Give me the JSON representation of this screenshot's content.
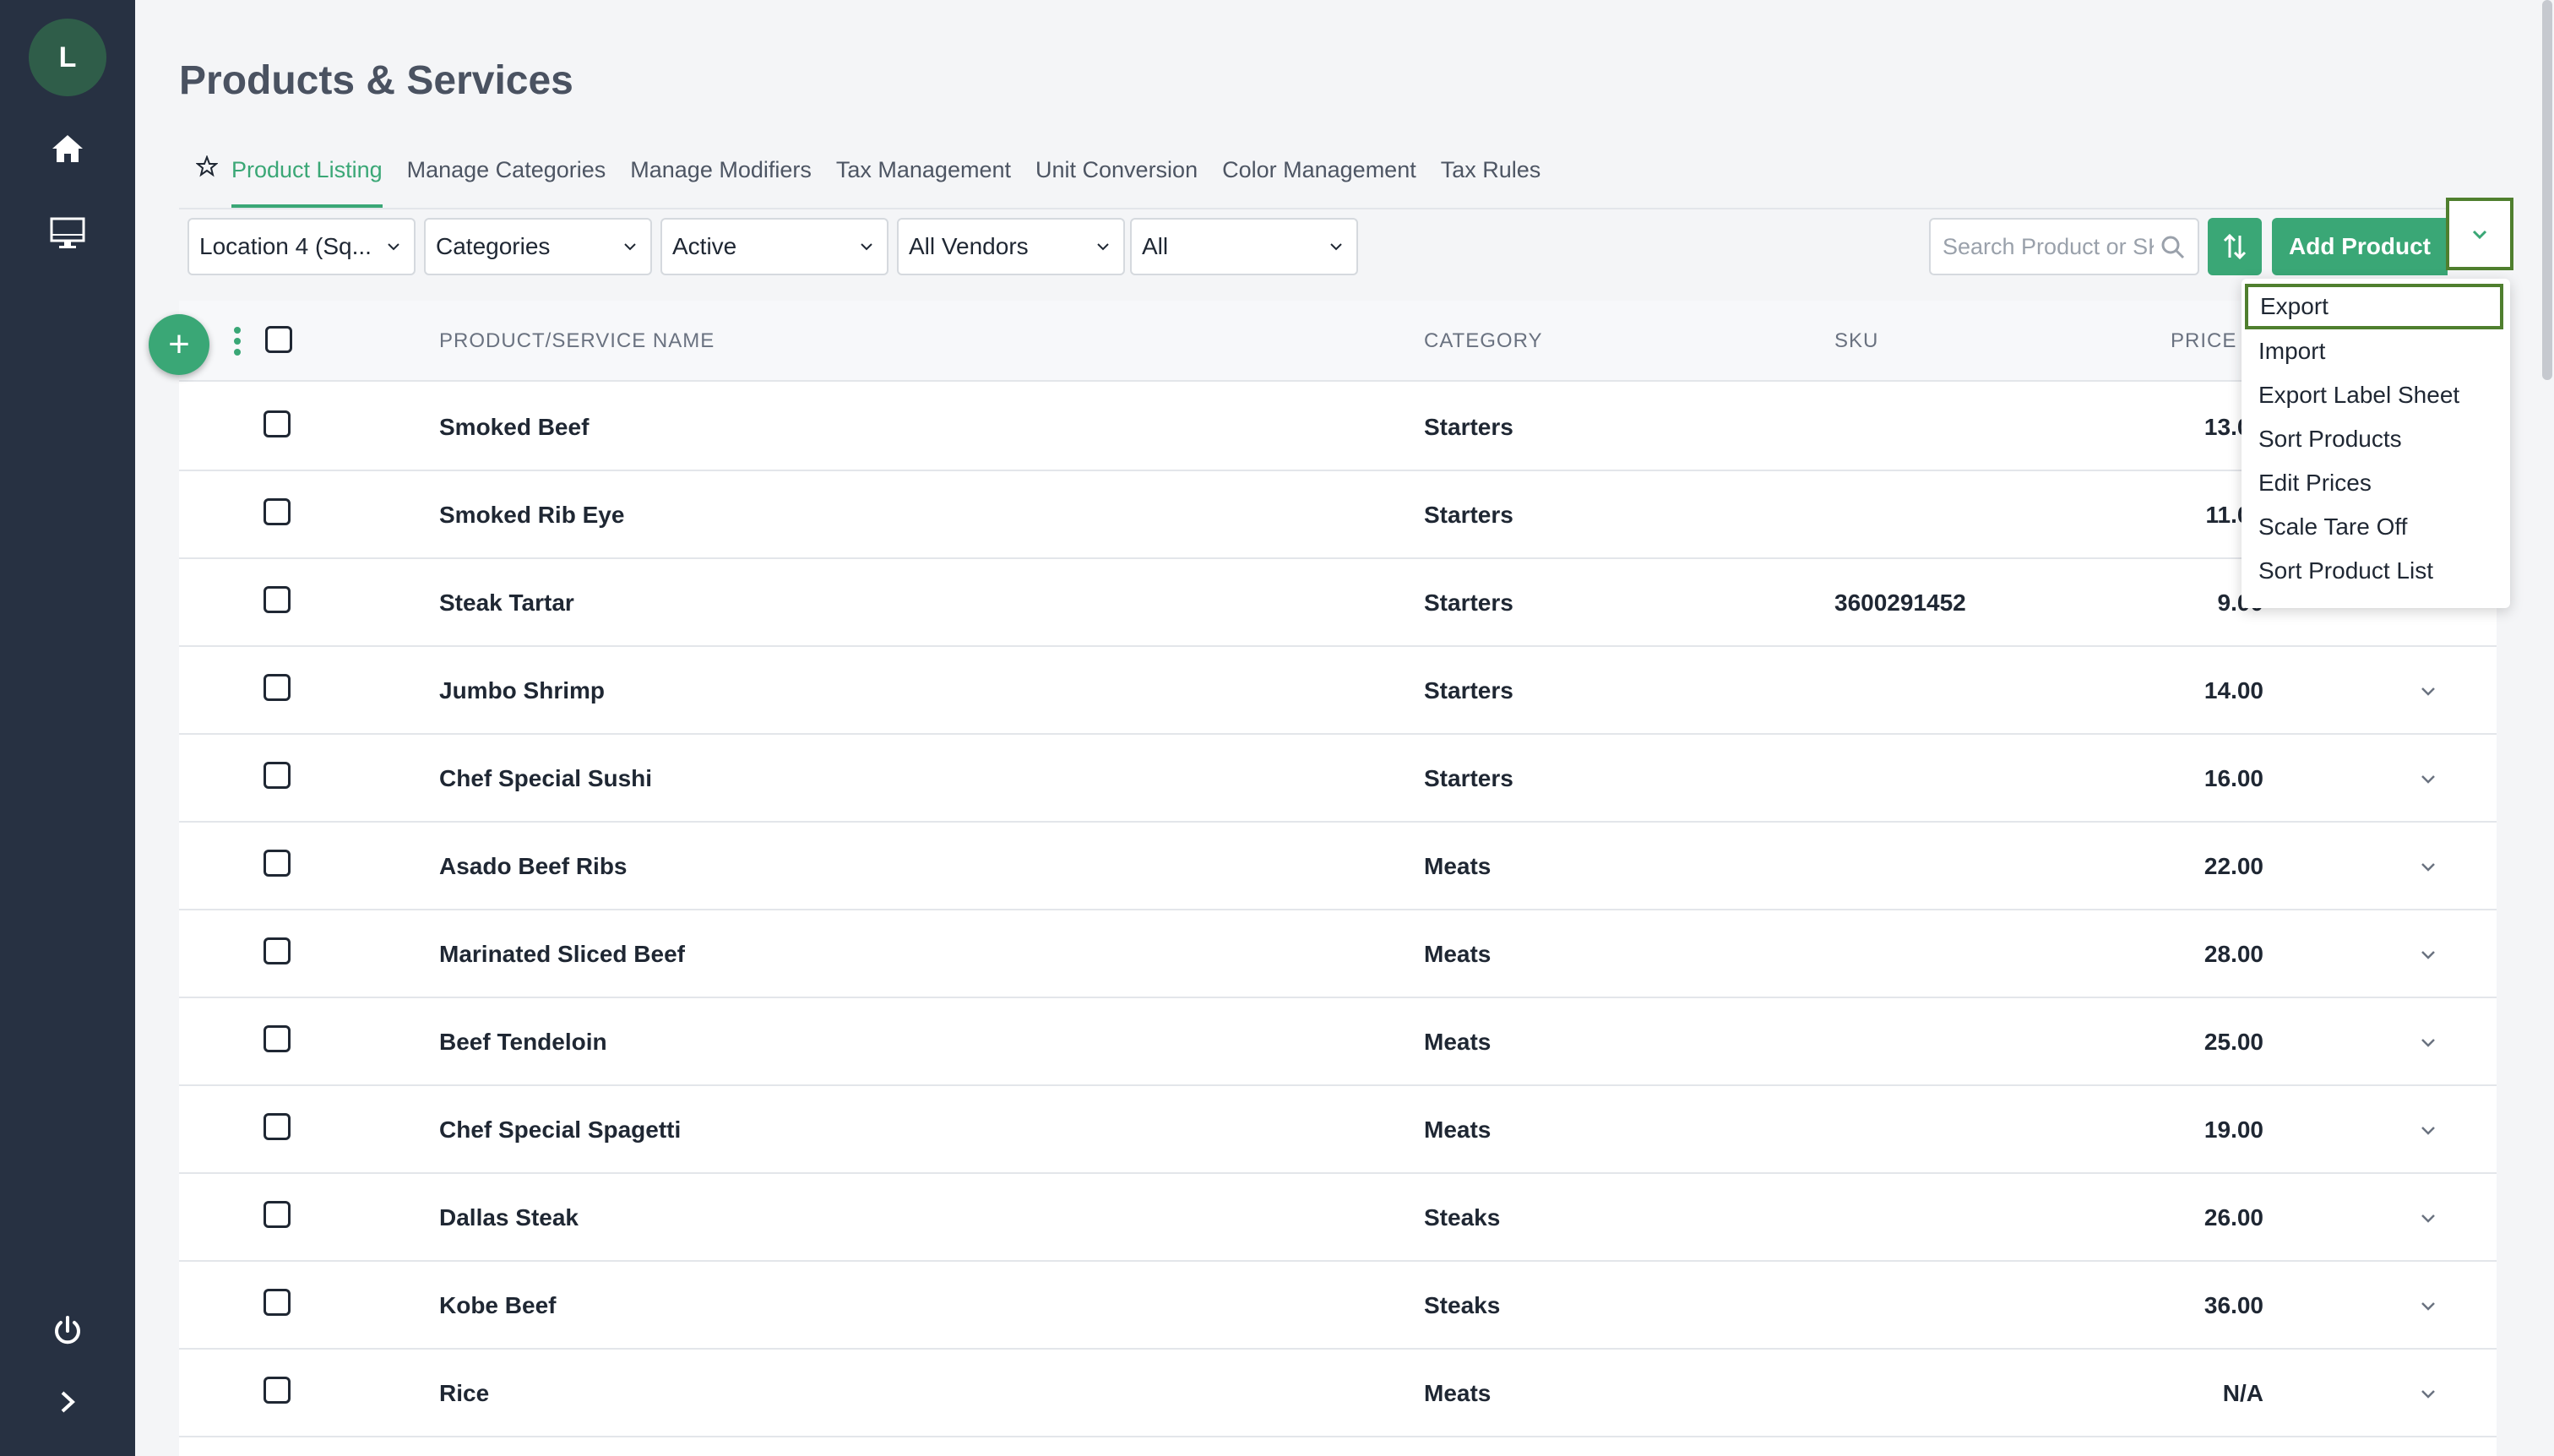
{
  "sidebar": {
    "avatar_initial": "L",
    "items": [
      "home-icon",
      "monitor-icon"
    ],
    "bottom": [
      "power-icon",
      "chevron-right-icon"
    ]
  },
  "page": {
    "title": "Products & Services"
  },
  "tabs": [
    {
      "label": "Product Listing",
      "active": true
    },
    {
      "label": "Manage Categories"
    },
    {
      "label": "Manage Modifiers"
    },
    {
      "label": "Tax Management"
    },
    {
      "label": "Unit Conversion"
    },
    {
      "label": "Color Management"
    },
    {
      "label": "Tax Rules"
    }
  ],
  "filters": {
    "location": "Location 4 (Sq...",
    "categories": "Categories",
    "status": "Active",
    "vendors": "All Vendors",
    "all": "All"
  },
  "search": {
    "placeholder": "Search Product or SKU"
  },
  "toolbar": {
    "add_label": "Add Product"
  },
  "table": {
    "headers": {
      "name": "PRODUCT/SERVICE NAME",
      "category": "CATEGORY",
      "sku": "SKU",
      "price": "PRICE ("
    },
    "rows": [
      {
        "name": "Smoked Beef",
        "category": "Starters",
        "sku": "",
        "price": "13.00"
      },
      {
        "name": "Smoked Rib Eye",
        "category": "Starters",
        "sku": "",
        "price": "11.00"
      },
      {
        "name": "Steak Tartar",
        "category": "Starters",
        "sku": "3600291452",
        "price": "9.00"
      },
      {
        "name": "Jumbo Shrimp",
        "category": "Starters",
        "sku": "",
        "price": "14.00"
      },
      {
        "name": "Chef Special Sushi",
        "category": "Starters",
        "sku": "",
        "price": "16.00"
      },
      {
        "name": "Asado Beef Ribs",
        "category": "Meats",
        "sku": "",
        "price": "22.00"
      },
      {
        "name": "Marinated Sliced Beef",
        "category": "Meats",
        "sku": "",
        "price": "28.00"
      },
      {
        "name": "Beef Tendeloin",
        "category": "Meats",
        "sku": "",
        "price": "25.00"
      },
      {
        "name": "Chef Special Spagetti",
        "category": "Meats",
        "sku": "",
        "price": "19.00"
      },
      {
        "name": "Dallas Steak",
        "category": "Steaks",
        "sku": "",
        "price": "26.00"
      },
      {
        "name": "Kobe Beef",
        "category": "Steaks",
        "sku": "",
        "price": "36.00"
      },
      {
        "name": "Rice",
        "category": "Meats",
        "sku": "",
        "price": "N/A"
      }
    ]
  },
  "menu": {
    "items": [
      "Export",
      "Import",
      "Export Label Sheet",
      "Sort Products",
      "Edit Prices",
      "Scale Tare Off",
      "Sort Product List"
    ],
    "focused_index": 0
  },
  "colors": {
    "accent": "#3aa776",
    "sidebar": "#273142",
    "focus": "#4f7f2e"
  }
}
